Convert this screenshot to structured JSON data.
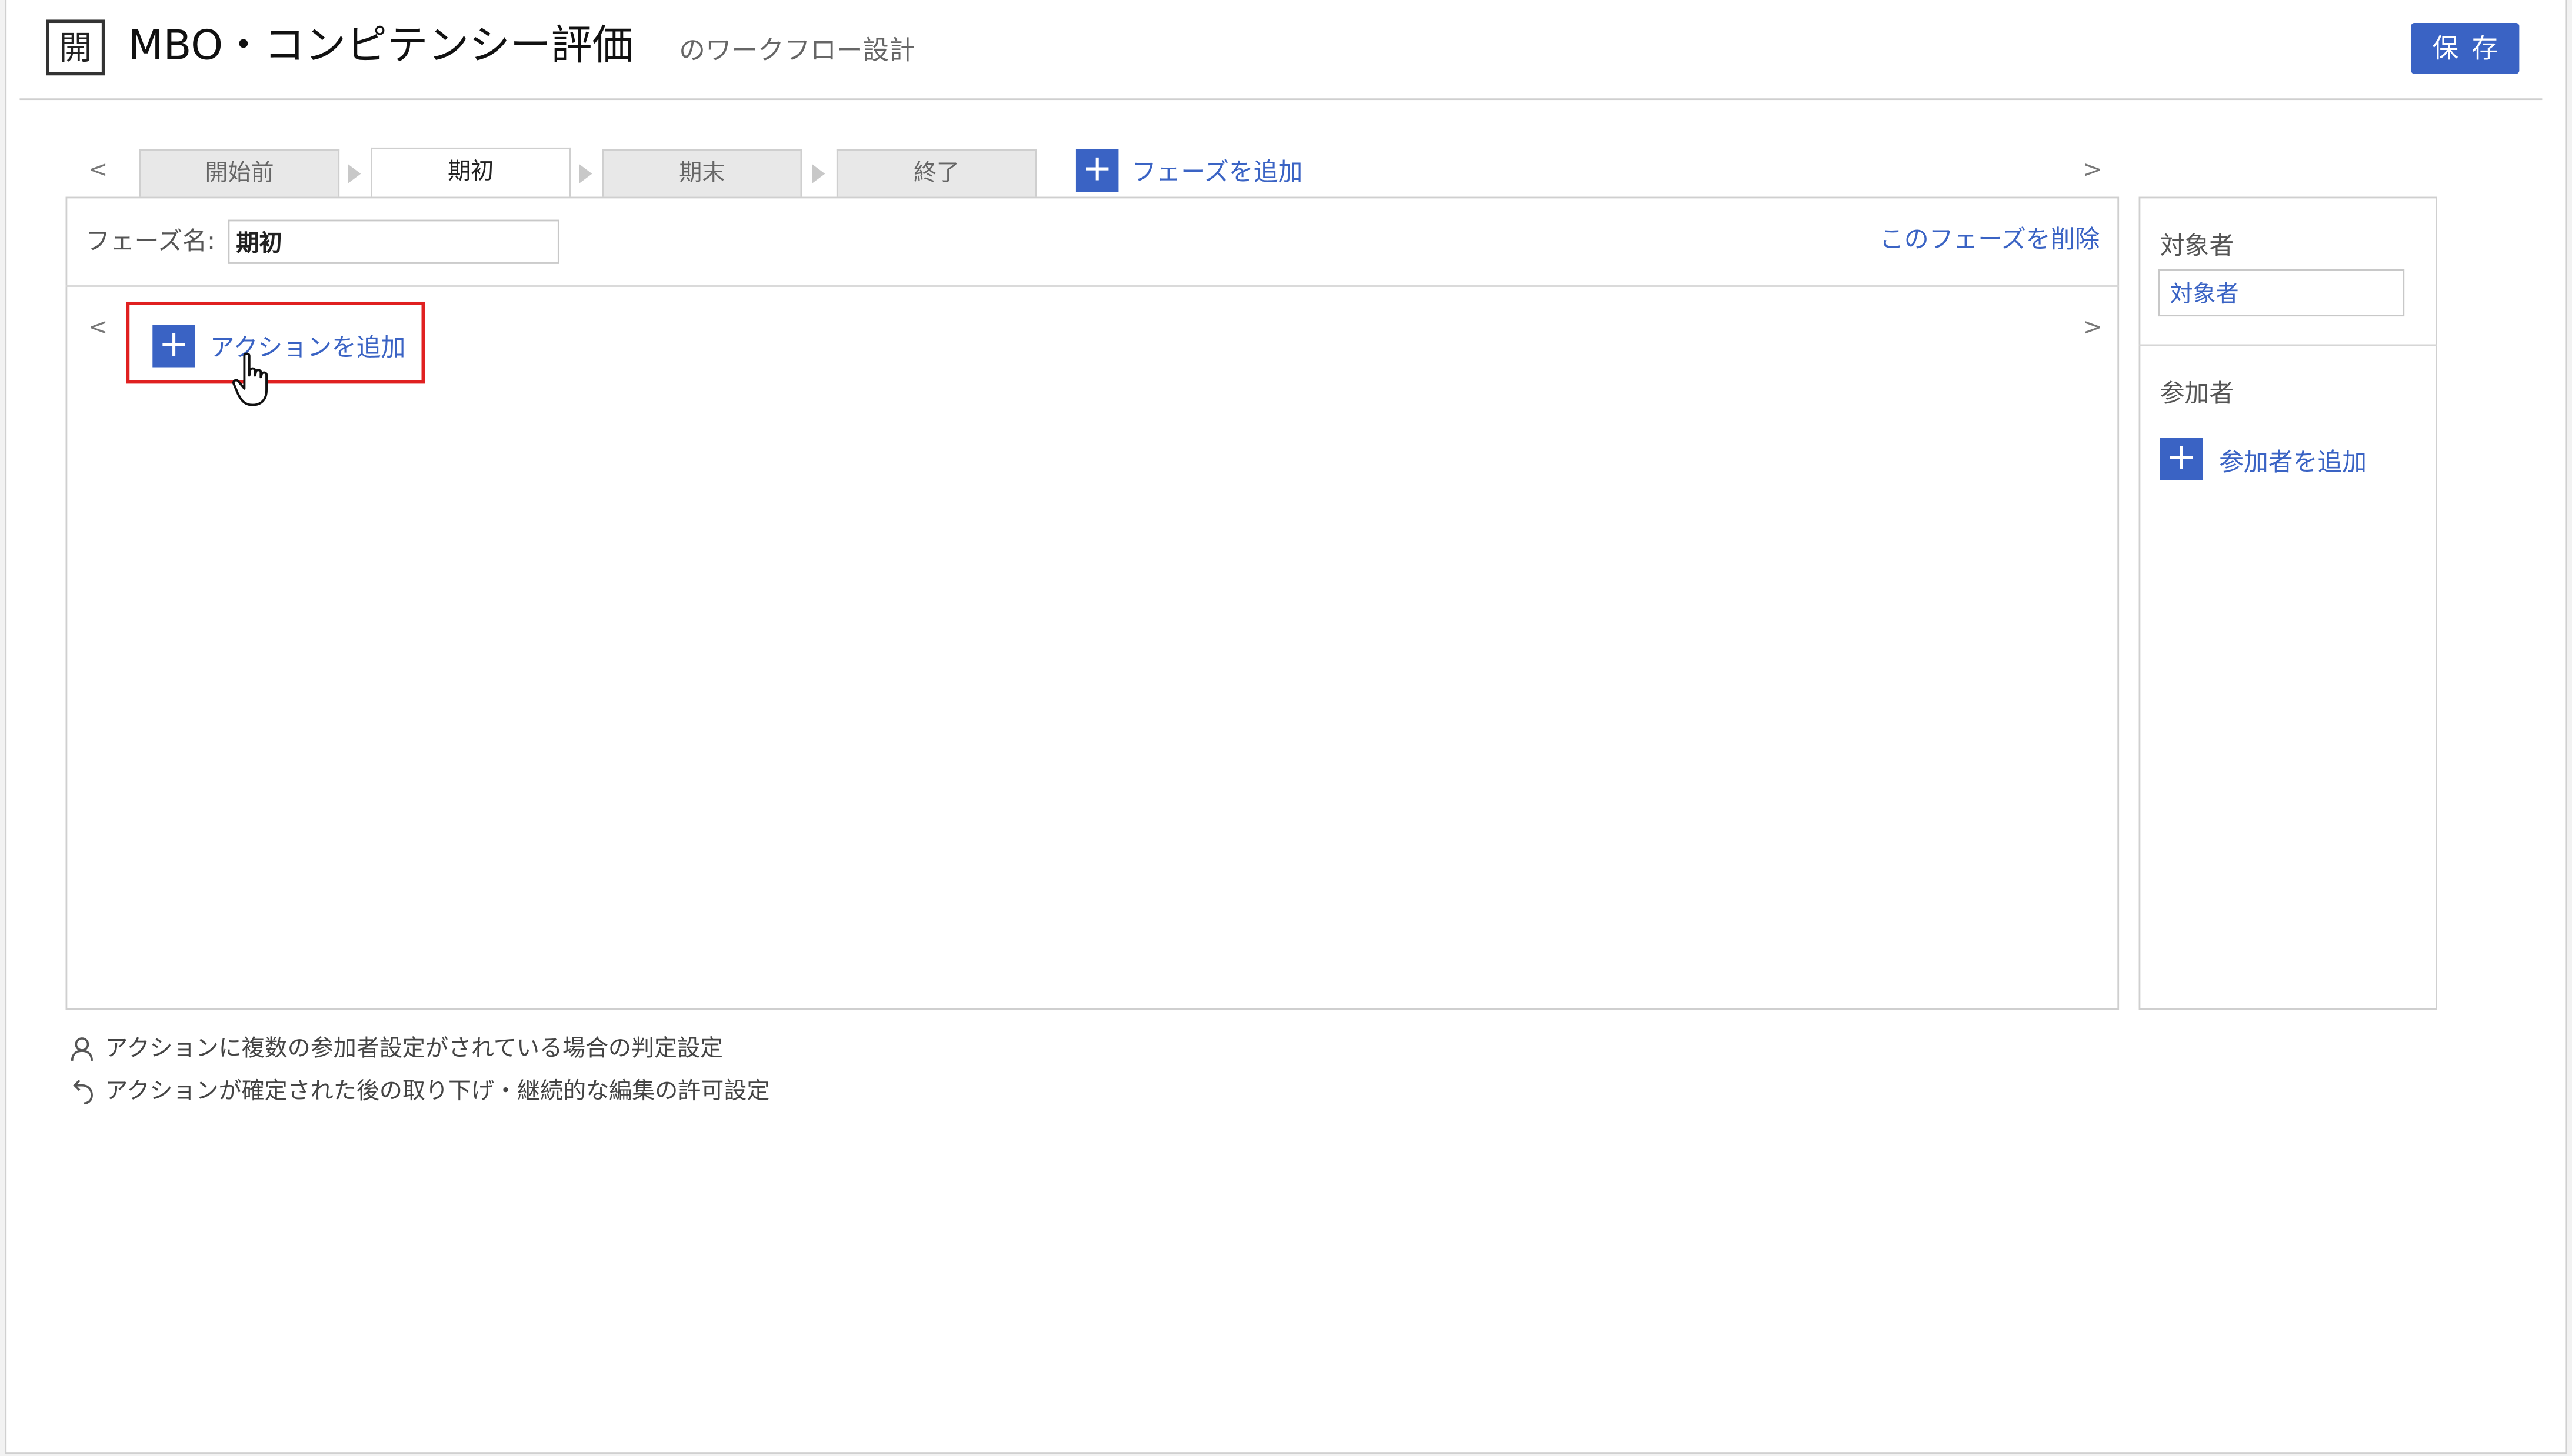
{
  "header": {
    "app_icon_char": "開",
    "title": "MBO・コンピテンシー評価",
    "subtitle": "のワークフロー設計",
    "save_label": "保存"
  },
  "phase_nav": {
    "prev_arrow": "<",
    "next_arrow": ">",
    "tabs": [
      {
        "label": "開始前",
        "active": false
      },
      {
        "label": "期初",
        "active": true
      },
      {
        "label": "期末",
        "active": false
      },
      {
        "label": "終了",
        "active": false
      }
    ],
    "add_phase_label": "フェーズを追加"
  },
  "phase_editor": {
    "name_label": "フェーズ名:",
    "name_value": "期初",
    "delete_label": "このフェーズを削除",
    "action_prev_arrow": "<",
    "action_next_arrow": ">",
    "add_action_label": "アクションを追加"
  },
  "side_panel": {
    "target_label": "対象者",
    "target_value": "対象者",
    "participants_label": "参加者",
    "add_participant_label": "参加者を追加"
  },
  "footnotes": [
    {
      "icon": "person-icon",
      "text": "アクションに複数の参加者設定がされている場合の判定設定"
    },
    {
      "icon": "undo-icon",
      "text": "アクションが確定された後の取り下げ・継続的な編集の許可設定"
    }
  ],
  "colors": {
    "accent": "#3a63c4",
    "highlight": "#e02020",
    "tab_inactive": "#e8e8e8"
  }
}
